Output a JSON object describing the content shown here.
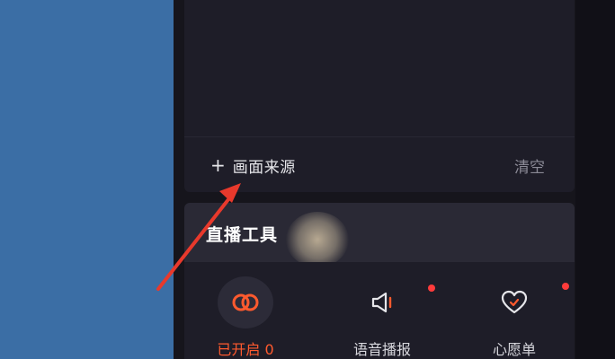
{
  "source_panel": {
    "add_plus": "+",
    "add_label": "画面来源",
    "clear_label": "清空"
  },
  "tools": {
    "title": "直播工具",
    "items": [
      {
        "label": "已开启 0",
        "icon": "linked-rings-icon",
        "active": true
      },
      {
        "label": "语音播报",
        "icon": "speaker-icon",
        "has_dot": true
      },
      {
        "label": "心愿单",
        "icon": "heart-icon",
        "has_dot": true
      }
    ]
  },
  "colors": {
    "background_blue": "#3b6ea5",
    "panel_dark": "#16151c",
    "accent_orange": "#ff5a2e",
    "annotation_red": "#e8392c",
    "notification_dot": "#ff3b3b"
  }
}
